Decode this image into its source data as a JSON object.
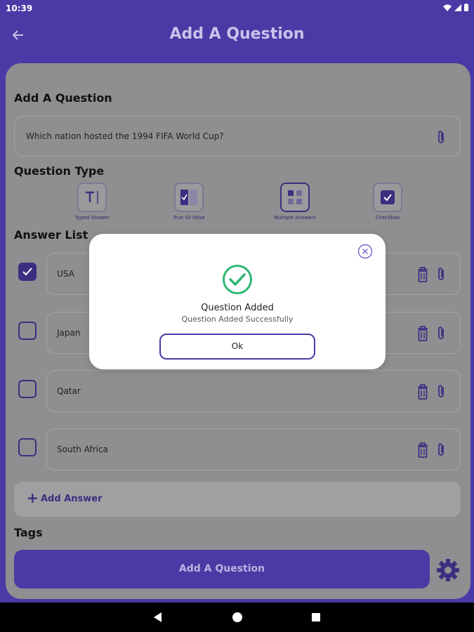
{
  "status": {
    "time": "10:39"
  },
  "appbar": {
    "title": "Add A Question"
  },
  "form": {
    "question_section_title": "Add A Question",
    "question_text": "Which nation hosted the 1994 FIFA World Cup?",
    "type_section_title": "Question Type",
    "types": [
      {
        "label": "Typed Answer",
        "icon": "typed-answer-icon",
        "selected": false
      },
      {
        "label": "True Or False",
        "icon": "true-false-icon",
        "selected": false
      },
      {
        "label": "Multiple Answers",
        "icon": "multiple-answers-icon",
        "selected": true
      },
      {
        "label": "Checkbox",
        "icon": "checkbox-type-icon",
        "selected": false
      }
    ],
    "answers_section_title": "Answer List",
    "answers": [
      {
        "text": "USA",
        "checked": true
      },
      {
        "text": "Japan",
        "checked": false
      },
      {
        "text": "Qatar",
        "checked": false
      },
      {
        "text": "South Africa",
        "checked": false
      }
    ],
    "add_answer_label": "Add Answer",
    "tags_section_title": "Tags",
    "submit_label": "Add A Question"
  },
  "dialog": {
    "title": "Question Added",
    "subtitle": "Question Added Successfully",
    "ok_label": "Ok"
  },
  "colors": {
    "primary": "#4a3aa5",
    "success": "#2eb872",
    "overlay_sheet": "#8f8f91"
  }
}
